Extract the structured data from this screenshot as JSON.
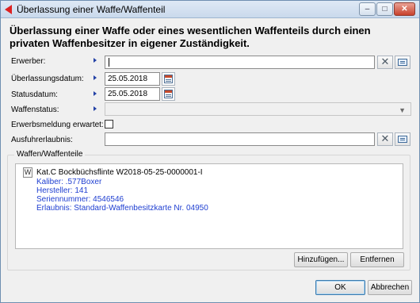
{
  "window": {
    "title": "Überlassung einer Waffe/Waffenteil",
    "minimize": "–",
    "maximize": "□",
    "close": "✕"
  },
  "header": "Überlassung einer Waffe oder eines wesentlichen Waffenteils durch einen privaten Waffenbesitzer in eigener Zuständigkeit.",
  "form": {
    "erwerber": {
      "label": "Erwerber:",
      "value": ""
    },
    "ueberlassungsdatum": {
      "label": "Überlassungsdatum:",
      "value": "25.05.2018"
    },
    "statusdatum": {
      "label": "Statusdatum:",
      "value": "25.05.2018"
    },
    "waffenstatus": {
      "label": "Waffenstatus:",
      "value": ""
    },
    "erwerbsmeldung": {
      "label": "Erwerbsmeldung erwartet:",
      "checked": false
    },
    "ausfuhrerlaubnis": {
      "label": "Ausfuhrerlaubnis:",
      "value": ""
    },
    "clear_glyph": "✕"
  },
  "waffen": {
    "group_label": "Waffen/Waffenteile",
    "items": [
      {
        "icon_letter": "W",
        "title": "Kat.C Bockbüchsflinte W2018-05-25-0000001-I",
        "details": [
          "Kaliber: .577Boxer",
          "Hersteller: 141",
          "Seriennummer: 4546546",
          "Erlaubnis: Standard-Waffenbesitzkarte Nr. 04950"
        ]
      }
    ],
    "add_button": "Hinzufügen...",
    "remove_button": "Entfernen"
  },
  "footer": {
    "ok": "OK",
    "cancel": "Abbrechen"
  },
  "colors": {
    "accent_arrow": "#2341a6",
    "detail_text": "#1f3fd1",
    "close_button": "#c8412c"
  }
}
